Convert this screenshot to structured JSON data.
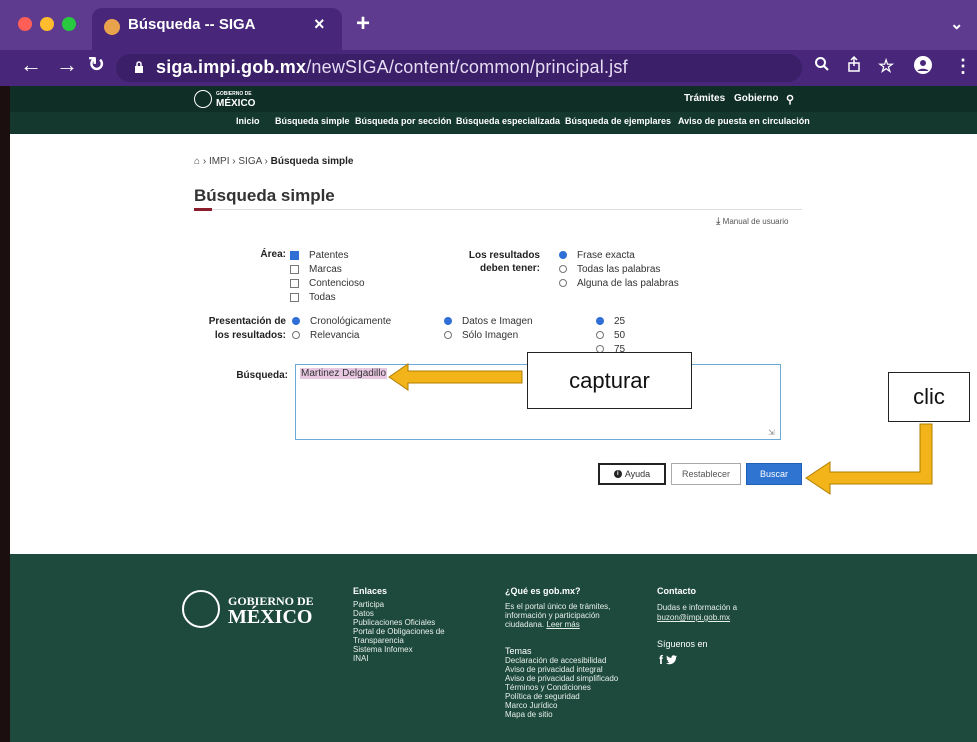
{
  "browser": {
    "tab_title": "Búsqueda -- SIGA",
    "tab_close": "×",
    "new_tab": "+",
    "url_host": "siga.impi.gob.mx",
    "url_path": "/newSIGA/content/common/principal.jsf"
  },
  "gov": {
    "logo_top": "GOBIERNO DE",
    "logo_bottom": "MÉXICO",
    "links": [
      "Trámites",
      "Gobierno"
    ],
    "nav": [
      "Inicio",
      "Búsqueda simple",
      "Búsqueda por sección",
      "Búsqueda especializada",
      "Búsqueda de ejemplares",
      "Aviso de puesta en circulación"
    ]
  },
  "page": {
    "breadcrumb": [
      "IMPI",
      "SIGA",
      "Búsqueda simple"
    ],
    "title": "Búsqueda simple",
    "manual": "Manual de usuario"
  },
  "form": {
    "area_label": "Área:",
    "area_options": [
      {
        "label": "Patentes",
        "checked": true
      },
      {
        "label": "Marcas",
        "checked": false
      },
      {
        "label": "Contencioso",
        "checked": false
      },
      {
        "label": "Todas",
        "checked": false
      }
    ],
    "results_label_1": "Los resultados",
    "results_label_2": "deben tener:",
    "results_options": [
      {
        "label": "Frase exacta",
        "selected": true
      },
      {
        "label": "Todas las palabras",
        "selected": false
      },
      {
        "label": "Alguna de las palabras",
        "selected": false
      }
    ],
    "presentation_label_1": "Presentación de",
    "presentation_label_2": "los resultados:",
    "presentation_options": [
      {
        "label": "Cronológicamente",
        "selected": true
      },
      {
        "label": "Relevancia",
        "selected": false
      }
    ],
    "type_options": [
      {
        "label": "Datos e Imagen",
        "selected": true
      },
      {
        "label": "Sólo Imagen",
        "selected": false
      }
    ],
    "count_options": [
      {
        "label": "25",
        "selected": true
      },
      {
        "label": "50",
        "selected": false
      },
      {
        "label": "75",
        "selected": false
      }
    ],
    "search_label": "Búsqueda:",
    "search_value": "Martinez Delgadillo",
    "help_button": "Ayuda",
    "reset_button": "Restablecer",
    "search_button": "Buscar"
  },
  "annotations": {
    "capture": "capturar",
    "click": "clic",
    "arrow_color": "#f2b418"
  },
  "footer": {
    "logo_top": "GOBIERNO DE",
    "logo_bottom": "MÉXICO",
    "links_title": "Enlaces",
    "links": [
      "Participa",
      "Datos",
      "Publicaciones Oficiales",
      "Portal de Obligaciones de",
      "Transparencia",
      "Sistema Infomex",
      "INAI"
    ],
    "about_title": "¿Qué es gob.mx?",
    "about_text": [
      "Es el portal único de trámites,",
      "información y participación",
      "ciudadana."
    ],
    "about_more": "Leer más",
    "topics_title": "Temas",
    "topics": [
      "Declaración de accesibilidad",
      "Aviso de privacidad integral",
      "Aviso de privacidad simplificado",
      "Términos y Condiciones",
      "Política de seguridad",
      "Marco Jurídico",
      "Mapa de sitio"
    ],
    "contact_title": "Contacto",
    "contact_text": "Dudas e información a",
    "contact_email": "buzon@impi.gob.mx",
    "follow": "Síguenos en",
    "social": "f"
  }
}
